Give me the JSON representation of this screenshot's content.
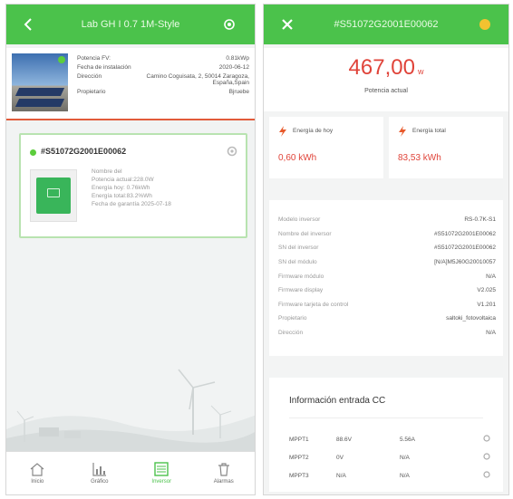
{
  "left_screen": {
    "header": {
      "title": "Lab GH I 0.7 1M-Style",
      "back_icon": "back-arrow-icon",
      "settings_icon": "gear-icon"
    },
    "plant": {
      "fields": [
        {
          "label": "Potencia FV:",
          "value": "0.81kWp"
        },
        {
          "label": "Fecha de instalación",
          "value": "2020-06-12"
        },
        {
          "label": "Dirección",
          "value": "Camino Coguisata, 2, 50014 Zaragoza, España,Spain"
        },
        {
          "label": "Propietario",
          "value": "Bjruebe"
        }
      ]
    },
    "inverter": {
      "sn": "#S51072G2001E00062",
      "details": [
        "Nombre del",
        "Potencia actual:228.0W",
        "Energía hoy: 0.76kWh",
        "Energía total:83.2%Wh",
        "Fecha de garantía 2025-07-18"
      ]
    },
    "nav": [
      {
        "label": "Inicio",
        "icon": "home-icon",
        "active": false
      },
      {
        "label": "Gráfico",
        "icon": "chart-icon",
        "active": false
      },
      {
        "label": "Inversor",
        "icon": "inverter-icon",
        "active": true
      },
      {
        "label": "Alarmas",
        "icon": "trash-icon",
        "active": false
      }
    ]
  },
  "right_screen": {
    "header": {
      "title": "#S51072G2001E00062",
      "close_icon": "close-icon",
      "status_color": "#f2c230"
    },
    "power": {
      "value": "467,00",
      "unit": "w",
      "label": "Potencia actual"
    },
    "energy_today": {
      "label": "Energía de hoy",
      "value": "0,60 kWh"
    },
    "energy_total": {
      "label": "Energía total",
      "value": "83,53 kWh"
    },
    "info": [
      {
        "key": "Modelo inversor",
        "value": "RS-0.7K-S1"
      },
      {
        "key": "Nombre del inversor",
        "value": "#S51072G2001E00062"
      },
      {
        "key": "SN del inversor",
        "value": "#S51072G2001E00062"
      },
      {
        "key": "SN del módulo",
        "value": "[N/A]M5J60G20010057"
      },
      {
        "key": "Firmware módulo",
        "value": "N/A"
      },
      {
        "key": "Firmware display",
        "value": "V2.025"
      },
      {
        "key": "Firmware tarjeta de control",
        "value": "V1.201"
      },
      {
        "key": "Propietario",
        "value": "saltoki_fotovoltaica"
      },
      {
        "key": "Dirección",
        "value": "N/A"
      }
    ],
    "dc": {
      "title": "Información entrada CC",
      "rows": [
        {
          "name": "MPPT1",
          "voltage": "88.6V",
          "current": "5.56A"
        },
        {
          "name": "MPPT2",
          "voltage": "0V",
          "current": "N/A"
        },
        {
          "name": "MPPT3",
          "voltage": "N/A",
          "current": "N/A"
        }
      ]
    }
  },
  "colors": {
    "brand_green": "#4bc24b",
    "accent_red": "#e0443a",
    "divider_orange": "#e25b3a"
  }
}
